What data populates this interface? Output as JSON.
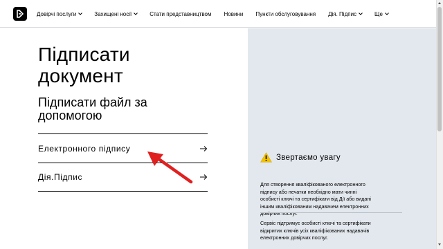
{
  "header": {
    "nav": [
      {
        "label": "Довірчі послуги",
        "has_dropdown": true
      },
      {
        "label": "Захищені носії",
        "has_dropdown": true
      },
      {
        "label": "Стати представництвом",
        "has_dropdown": false
      },
      {
        "label": "Новини",
        "has_dropdown": false
      },
      {
        "label": "Пункти обслуговування",
        "has_dropdown": false
      },
      {
        "label": "Дія. Підпис",
        "has_dropdown": true
      },
      {
        "label": "Ще",
        "has_dropdown": true
      }
    ]
  },
  "main": {
    "title_line1": "Підписати",
    "title_line2": "документ",
    "subtitle_line1": "Підписати файл за",
    "subtitle_line2": "допомогою",
    "options": [
      {
        "label": "Електронного підпису"
      },
      {
        "label": "Дія.Підпис"
      }
    ]
  },
  "notice": {
    "title": "Звертаємо увагу",
    "icon": "warning-icon",
    "paragraph1_lines": [
      "Для створення кваліфікованого електронного",
      "підпису або печатки необхідно мати чинні",
      "особисті ключі та сертифікати від Дії або видані",
      "іншим кваліфікованим надавачем електронних",
      "довірчих послуг."
    ],
    "paragraph2_lines": [
      "Сервіс підтримує особисті ключі та сертифікати",
      "відкритих ключів усіх кваліфікованих надавачів",
      "електронних довірчих послуг."
    ]
  },
  "colors": {
    "side_panel": "#e3e8ee",
    "annotation_arrow": "#e02020",
    "warning": "#f2c200"
  }
}
